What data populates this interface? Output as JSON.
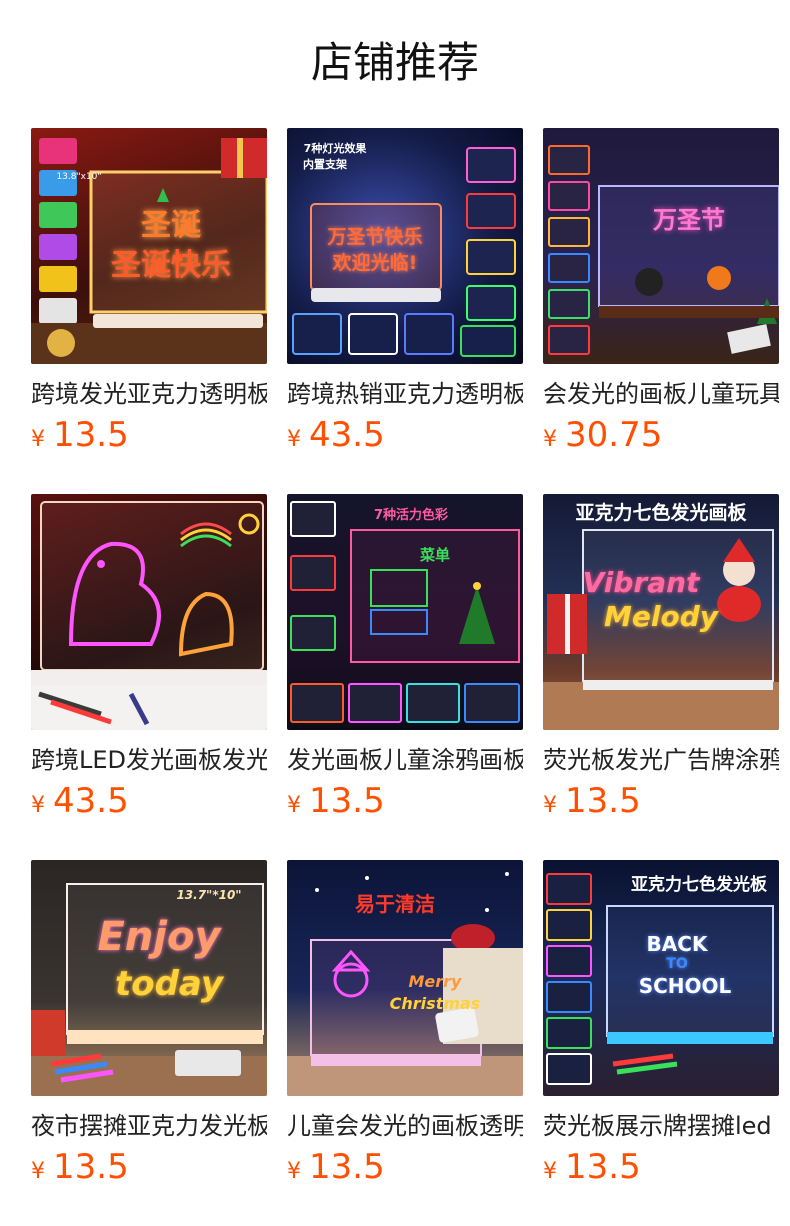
{
  "section": {
    "title": "店铺推荐"
  },
  "colors": {
    "price": "#ff4f00",
    "title": "#111111"
  },
  "products": [
    {
      "title": "跨境发光亚克力透明板",
      "currency": "¥",
      "price": "13.5",
      "image_text": {
        "main": "圣诞",
        "sub": "圣诞快乐",
        "size": "13.8\"x10\""
      }
    },
    {
      "title": "跨境热销亚克力透明板",
      "currency": "¥",
      "price": "43.5",
      "image_text": {
        "main": "万圣节快乐",
        "sub": "欢迎光临!",
        "header": "7种灯光效果",
        "header2": "内置支架"
      }
    },
    {
      "title": "会发光的画板儿童玩具",
      "currency": "¥",
      "price": "30.75",
      "image_text": {
        "main": "万圣节"
      }
    },
    {
      "title": "跨境LED发光画板发光",
      "currency": "¥",
      "price": "43.5",
      "image_text": {}
    },
    {
      "title": "发光画板儿童涂鸦画板",
      "currency": "¥",
      "price": "13.5",
      "image_text": {
        "header": "7种活力色彩",
        "main": "菜单"
      }
    },
    {
      "title": "荧光板发光广告牌涂鸦",
      "currency": "¥",
      "price": "13.5",
      "image_text": {
        "header": "亚克力七色发光画板",
        "main": "Vibrant",
        "sub": "Melody"
      }
    },
    {
      "title": "夜市摆摊亚克力发光板",
      "currency": "¥",
      "price": "13.5",
      "image_text": {
        "main": "Enjoy",
        "sub": "today",
        "size": "13.7\"*10\""
      }
    },
    {
      "title": "儿童会发光的画板透明",
      "currency": "¥",
      "price": "13.5",
      "image_text": {
        "header": "易于清洁",
        "main": "Merry",
        "sub": "Christmas"
      }
    },
    {
      "title": "荧光板展示牌摆摊led",
      "currency": "¥",
      "price": "13.5",
      "image_text": {
        "header": "亚克力七色发光板",
        "main": "BACK",
        "mid": "TO",
        "sub": "SCHOOL"
      }
    }
  ]
}
